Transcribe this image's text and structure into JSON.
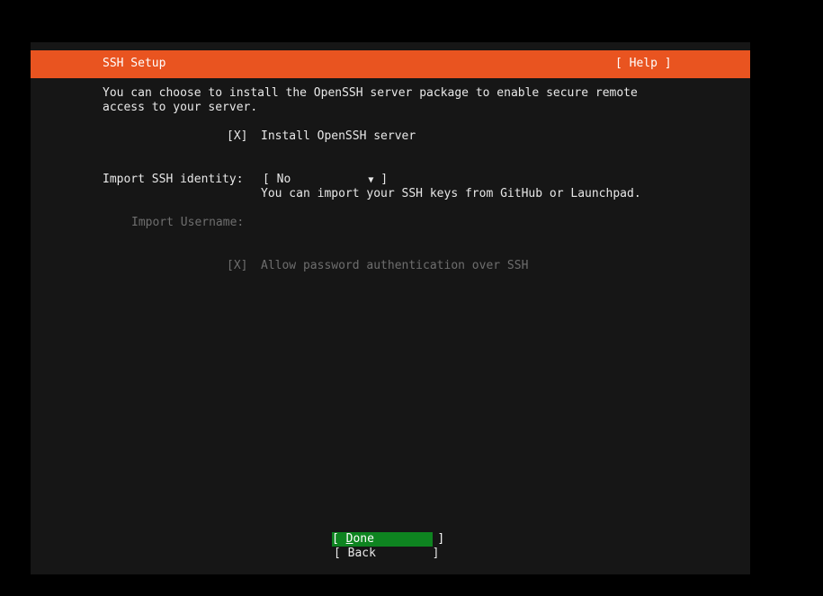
{
  "header": {
    "title": "SSH Setup",
    "help_label": "[ Help ]"
  },
  "intro": {
    "line1": "You can choose to install the OpenSSH server package to enable secure remote",
    "line2": "access to your server."
  },
  "install_openssh": {
    "checkbox": "[X]",
    "label": "Install OpenSSH server"
  },
  "import_identity": {
    "label": "Import SSH identity:",
    "selected": "No",
    "help": "You can import your SSH keys from GitHub or Launchpad."
  },
  "import_username": {
    "label": "Import Username:"
  },
  "password_auth": {
    "checkbox": "[X]",
    "label": "Allow password authentication over SSH"
  },
  "buttons": {
    "done_open": "[ ",
    "done_hotkey": "D",
    "done_rest": "one",
    "done_close": "]",
    "back_open": "[ ",
    "back_label": "Back",
    "back_close": "]"
  },
  "colors": {
    "header_bg": "#e95420",
    "focused_button_bg": "#0e8420",
    "screen_bg": "#161616",
    "disabled_text": "#6e6e6e"
  }
}
